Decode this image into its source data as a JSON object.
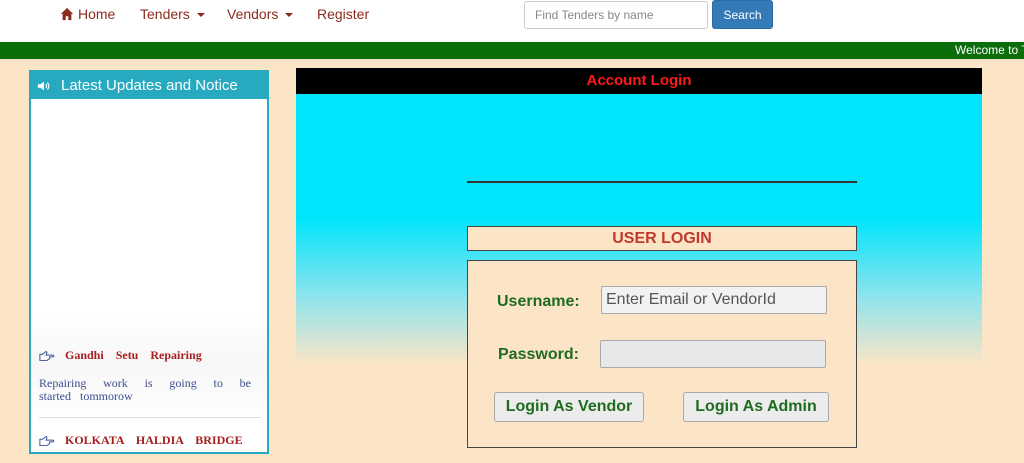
{
  "nav": {
    "home": "Home",
    "tenders": "Tenders",
    "vendors": "Vendors",
    "register": "Register",
    "search_placeholder": "Find Tenders by name",
    "search_button": "Search"
  },
  "marquee": {
    "text": "Welcome to T"
  },
  "notice": {
    "header": "Latest Updates and Notice",
    "items": [
      {
        "title": "Gandhi Setu Repairing",
        "description": "Repairing work is going to be started tommorow"
      },
      {
        "title": "KOLKATA HALDIA BRIDGE"
      }
    ]
  },
  "login": {
    "header": "Account Login",
    "user_login": "USER LOGIN",
    "username_label": "Username:",
    "username_placeholder": "Enter Email or VendorId",
    "password_label": "Password:",
    "vendor_button": "Login As Vendor",
    "admin_button": "Login As Admin"
  },
  "colors": {
    "nav_text": "#8b2a1e",
    "search_button": "#337ab7",
    "marquee_bg": "#0a6e0a",
    "page_bg": "#fbe5c6",
    "notice_header": "#27a9c0",
    "login_panel": "#00e5fb",
    "login_header_text": "#ff1a1a",
    "form_label": "#1f6b1f"
  }
}
